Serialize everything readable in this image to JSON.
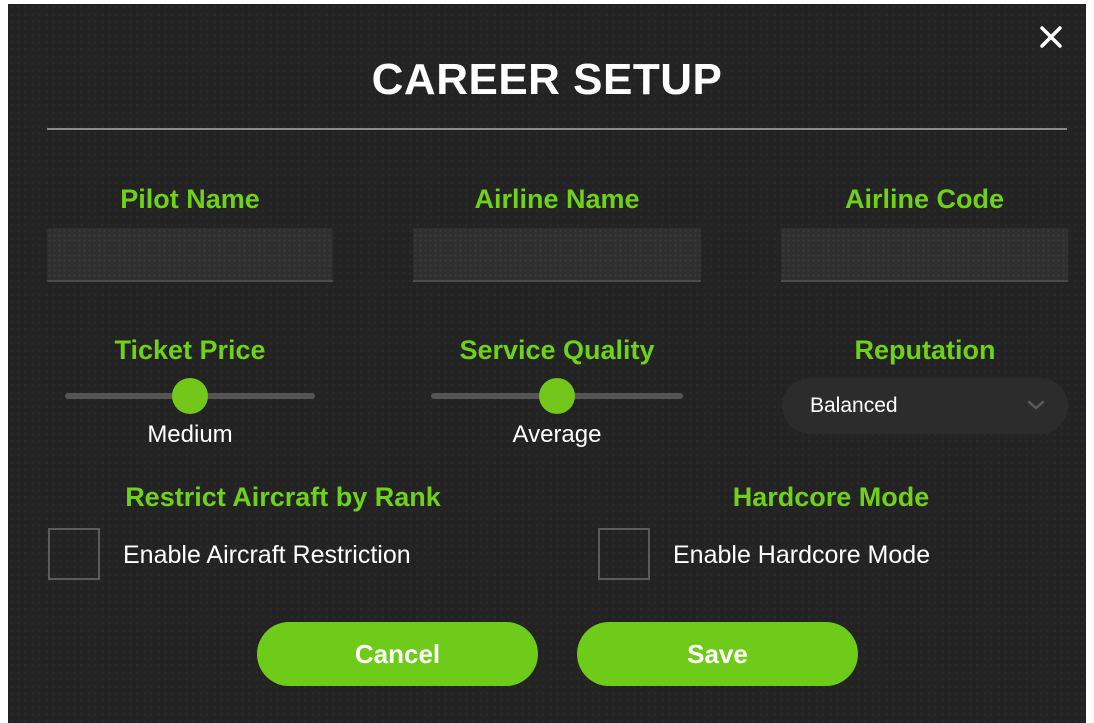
{
  "dialog": {
    "title": "CAREER SETUP",
    "close_icon": "close-x-icon"
  },
  "fields": {
    "pilot_name": {
      "label": "Pilot Name",
      "value": ""
    },
    "airline_name": {
      "label": "Airline Name",
      "value": ""
    },
    "airline_code": {
      "label": "Airline Code",
      "value": ""
    }
  },
  "sliders": {
    "ticket_price": {
      "label": "Ticket Price",
      "value_text": "Medium",
      "level": 0.5
    },
    "service_quality": {
      "label": "Service Quality",
      "value_text": "Average",
      "level": 0.5
    }
  },
  "reputation": {
    "label": "Reputation",
    "selected": "Balanced",
    "icon": "chevron-down-icon"
  },
  "options": {
    "restrict_aircraft": {
      "label": "Restrict Aircraft by Rank",
      "checkbox_label": "Enable Aircraft Restriction",
      "checked": false
    },
    "hardcore_mode": {
      "label": "Hardcore Mode",
      "checkbox_label": "Enable Hardcore Mode",
      "checked": false
    }
  },
  "buttons": {
    "cancel": "Cancel",
    "save": "Save"
  },
  "colors": {
    "background": "#232323",
    "accent_green": "#6fd11a",
    "button_green": "#6fcb1a",
    "text_white": "#ffffff"
  }
}
